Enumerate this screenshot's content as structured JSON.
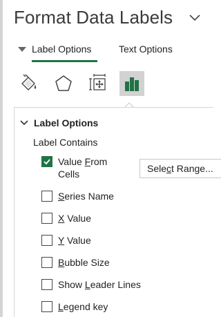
{
  "pane": {
    "title": "Format Data Labels",
    "collapse_icon": "chevron-down-icon"
  },
  "tabs": [
    {
      "label": "Label Options",
      "active": true
    },
    {
      "label": "Text Options",
      "active": false
    }
  ],
  "icon_toolbar": [
    {
      "icon": "paint-bucket-icon",
      "selected": false
    },
    {
      "icon": "pentagon-icon",
      "selected": false
    },
    {
      "icon": "size-properties-icon",
      "selected": false
    },
    {
      "icon": "bar-chart-icon",
      "selected": true
    }
  ],
  "section": {
    "title": "Label Options",
    "expanded": true,
    "group_label": "Label Contains",
    "options": [
      {
        "label_pre": "Value ",
        "label_key": "F",
        "label_post": "rom Cells",
        "checked": true
      },
      {
        "label_pre": "",
        "label_key": "S",
        "label_post": "eries Name",
        "checked": false
      },
      {
        "label_pre": "",
        "label_key": "X",
        "label_post": " Value",
        "checked": false
      },
      {
        "label_pre": "",
        "label_key": "Y",
        "label_post": " Value",
        "checked": false
      },
      {
        "label_pre": "",
        "label_key": "B",
        "label_post": "ubble Size",
        "checked": false
      },
      {
        "label_pre": "Show ",
        "label_key": "L",
        "label_post": "eader Lines",
        "checked": false
      },
      {
        "label_pre": "",
        "label_key": "L",
        "label_post": "egend key",
        "checked": false
      }
    ],
    "select_range": {
      "label_pre": "Sele",
      "label_key": "c",
      "label_post": "t Range..."
    }
  },
  "colors": {
    "accent": "#217346",
    "selected_bg": "#d2d2d2",
    "text": "#222222",
    "title_text": "#3a3a3a"
  }
}
